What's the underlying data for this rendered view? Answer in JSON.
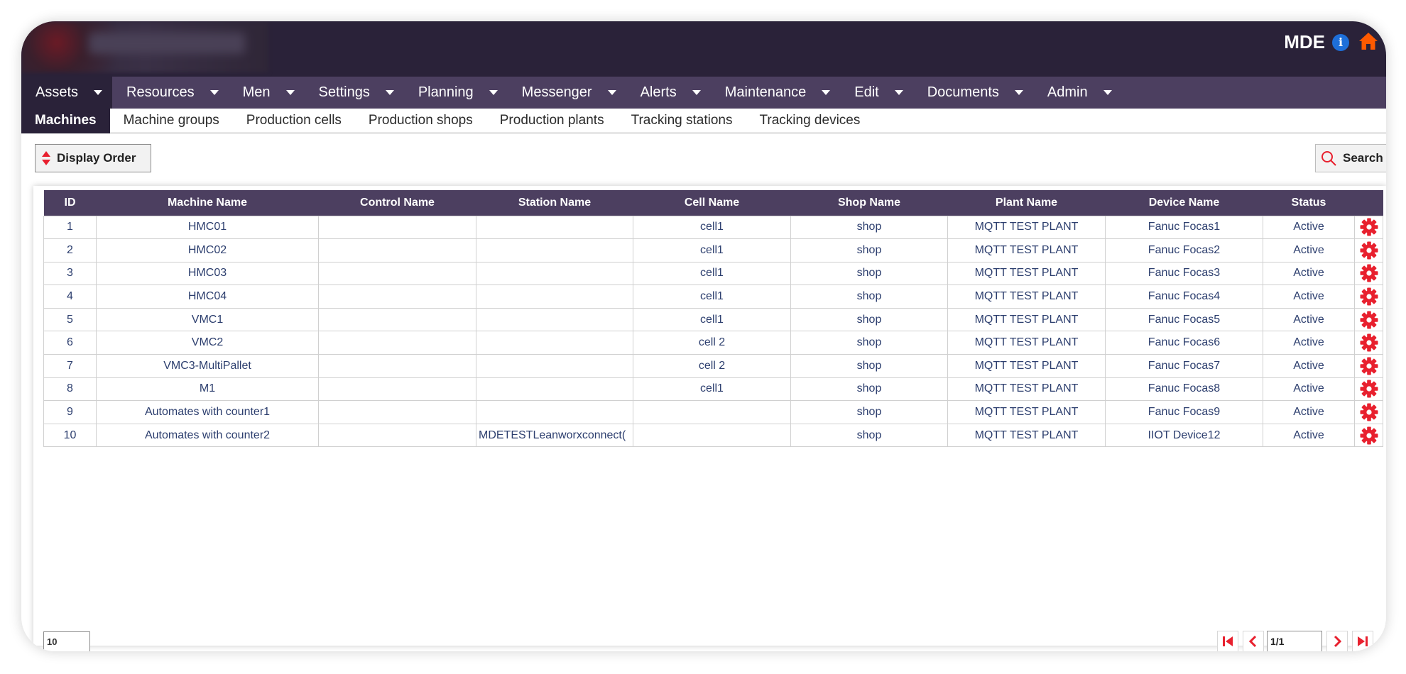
{
  "header": {
    "app_name": "MDE",
    "info_icon": "info-icon",
    "home_icon": "home-icon",
    "home_color": "#ff5a00",
    "info_color": "#1e6fd9"
  },
  "main_menu": [
    {
      "label": "Assets",
      "active": true
    },
    {
      "label": "Resources"
    },
    {
      "label": "Men"
    },
    {
      "label": "Settings"
    },
    {
      "label": "Planning"
    },
    {
      "label": "Messenger"
    },
    {
      "label": "Alerts"
    },
    {
      "label": "Maintenance"
    },
    {
      "label": "Edit"
    },
    {
      "label": "Documents"
    },
    {
      "label": "Admin"
    }
  ],
  "sub_menu": [
    {
      "label": "Machines",
      "active": true
    },
    {
      "label": "Machine groups"
    },
    {
      "label": "Production cells"
    },
    {
      "label": "Production shops"
    },
    {
      "label": "Production plants"
    },
    {
      "label": "Tracking stations"
    },
    {
      "label": "Tracking devices"
    }
  ],
  "toolbar": {
    "display_order_label": "Display Order",
    "search_label": "Search"
  },
  "table": {
    "columns": [
      "ID",
      "Machine Name",
      "Control Name",
      "Station Name",
      "Cell Name",
      "Shop Name",
      "Plant Name",
      "Device Name",
      "Status",
      ""
    ],
    "rows": [
      {
        "id": "1",
        "machine": "HMC01",
        "control": "",
        "station": "",
        "cell": "cell1",
        "shop": "shop",
        "plant": "MQTT TEST PLANT",
        "device": "Fanuc Focas1",
        "status": "Active"
      },
      {
        "id": "2",
        "machine": "HMC02",
        "control": "",
        "station": "",
        "cell": "cell1",
        "shop": "shop",
        "plant": "MQTT TEST PLANT",
        "device": "Fanuc Focas2",
        "status": "Active"
      },
      {
        "id": "3",
        "machine": "HMC03",
        "control": "",
        "station": "",
        "cell": "cell1",
        "shop": "shop",
        "plant": "MQTT TEST PLANT",
        "device": "Fanuc Focas3",
        "status": "Active"
      },
      {
        "id": "4",
        "machine": "HMC04",
        "control": "",
        "station": "",
        "cell": "cell1",
        "shop": "shop",
        "plant": "MQTT TEST PLANT",
        "device": "Fanuc Focas4",
        "status": "Active"
      },
      {
        "id": "5",
        "machine": "VMC1",
        "control": "",
        "station": "",
        "cell": "cell1",
        "shop": "shop",
        "plant": "MQTT TEST PLANT",
        "device": "Fanuc Focas5",
        "status": "Active"
      },
      {
        "id": "6",
        "machine": "VMC2",
        "control": "",
        "station": "",
        "cell": "cell 2",
        "shop": "shop",
        "plant": "MQTT TEST PLANT",
        "device": "Fanuc Focas6",
        "status": "Active"
      },
      {
        "id": "7",
        "machine": "VMC3-MultiPallet",
        "control": "",
        "station": "",
        "cell": "cell 2",
        "shop": "shop",
        "plant": "MQTT TEST PLANT",
        "device": "Fanuc Focas7",
        "status": "Active"
      },
      {
        "id": "8",
        "machine": "M1",
        "control": "",
        "station": "",
        "cell": "cell1",
        "shop": "shop",
        "plant": "MQTT TEST PLANT",
        "device": "Fanuc Focas8",
        "status": "Active"
      },
      {
        "id": "9",
        "machine": "Automates with counter1",
        "control": "",
        "station": "",
        "cell": "",
        "shop": "shop",
        "plant": "MQTT TEST PLANT",
        "device": "Fanuc Focas9",
        "status": "Active"
      },
      {
        "id": "10",
        "machine": "Automates with counter2",
        "control": "",
        "station": "MDETESTLeanworxconnect(",
        "cell": "",
        "shop": "shop",
        "plant": "MQTT TEST PLANT",
        "device": "IIOT Device12",
        "status": "Active"
      }
    ],
    "row_action_icon": "gear-icon",
    "row_action_color": "#e8202e"
  },
  "pagination": {
    "page_size": "10",
    "page_value": "1/1",
    "accent_color": "#e8202e"
  }
}
